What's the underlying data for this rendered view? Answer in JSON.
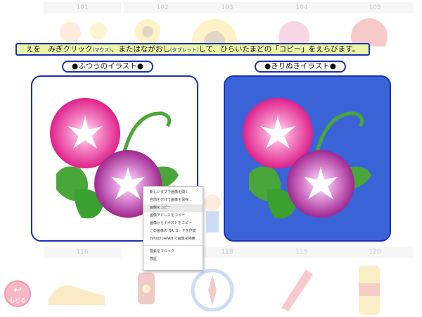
{
  "grid_numbers_top": [
    "101",
    "102",
    "103",
    "104",
    "105"
  ],
  "grid_numbers_bottom": [
    "116",
    "118",
    "119",
    "120"
  ],
  "instruction": {
    "part1": "えを　みぎクリック",
    "mouse": "(マウス)",
    "part2": "、またはながおし",
    "tablet": "(タブレット)",
    "part3": "して、ひらいたまどの「コピー」をえらびます。"
  },
  "normal_label": "●ふつうのイラスト●",
  "cutout_label": "●きりぬきイラスト●",
  "context_menu": {
    "items": [
      "新しいタブで画像を開く",
      "名前を付けて画像を保存...",
      "画像をコピー",
      "画像アドレスをコピー",
      "画像からテキストをコピー",
      "この画像の QR コードを作成",
      "Yahoo! JAPAN で画像を検索"
    ],
    "items2": [
      "要素をブロック",
      "検証"
    ],
    "highlighted": "画像をコピー"
  },
  "back_button": {
    "label": "もどる"
  },
  "colors": {
    "accent": "#1a2fb8",
    "banner_bg": "#eaf6a6",
    "cutout_bg": "#3b63d8"
  }
}
